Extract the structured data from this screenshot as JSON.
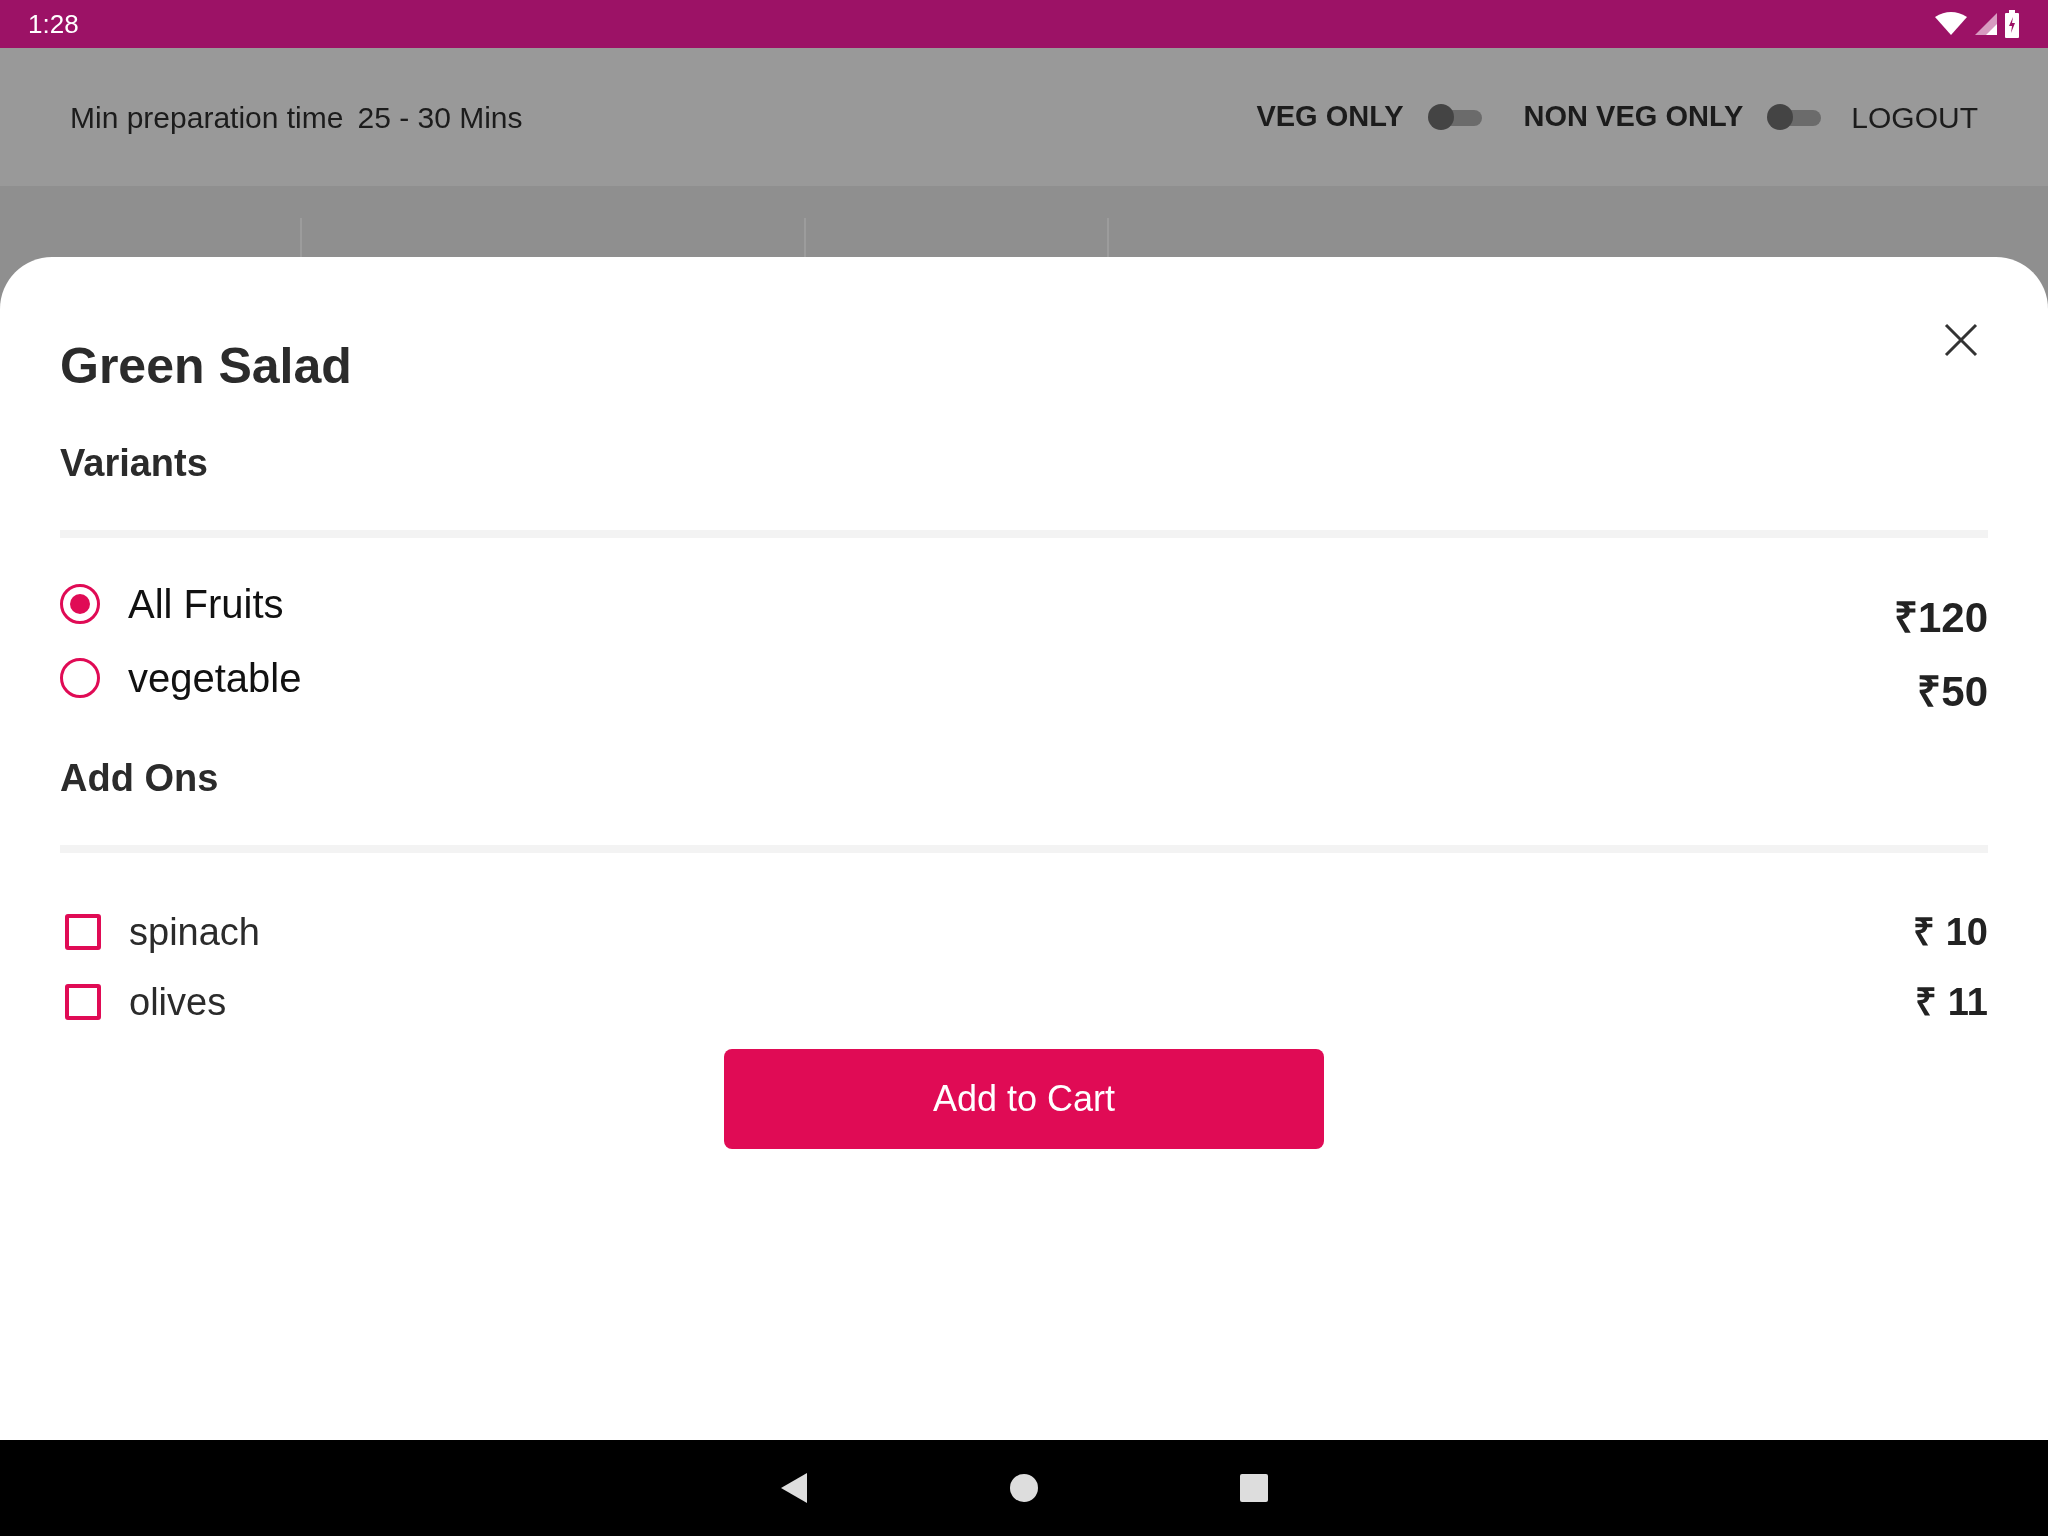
{
  "status_bar": {
    "time": "1:28"
  },
  "header": {
    "prep_label": "Min preparation time",
    "prep_value": "25 - 30 Mins",
    "toggles": [
      {
        "label": "VEG ONLY",
        "on": false
      },
      {
        "label": "NON VEG ONLY",
        "on": false
      }
    ],
    "logout": "LOGOUT"
  },
  "sheet": {
    "title": "Green Salad",
    "variants_heading": "Variants",
    "variants": [
      {
        "label": "All Fruits",
        "price": "₹120",
        "selected": true
      },
      {
        "label": "vegetable",
        "price": "₹50",
        "selected": false
      }
    ],
    "addons_heading": "Add Ons",
    "addons": [
      {
        "label": "spinach",
        "price": "₹ 10",
        "checked": false
      },
      {
        "label": "olives",
        "price": "₹ 11",
        "checked": false
      }
    ],
    "button": "Add to Cart"
  }
}
